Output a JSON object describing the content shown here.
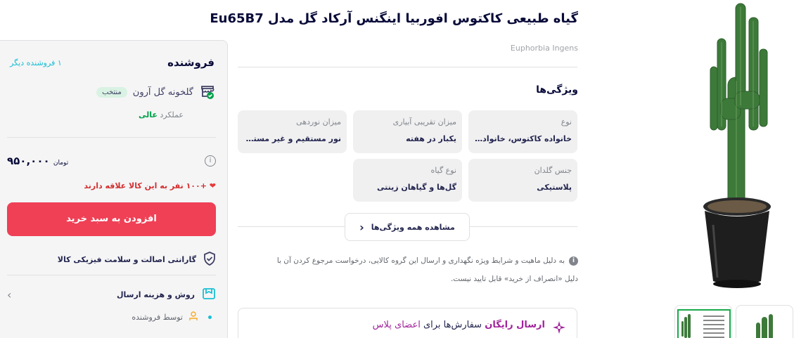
{
  "product": {
    "title": "گیاه طبیعی کاکتوس افوربیا اینگنس آرکاد گل مدل Eu65B7",
    "english_title": "Euphorbia Ingens"
  },
  "features": {
    "title": "ویژگی‌ها",
    "items": [
      {
        "key": "نوع",
        "value": "خانواده کاکتوس، خانواده‌س..."
      },
      {
        "key": "میزان تقریبی آبیاری",
        "value": "یکبار در هفته"
      },
      {
        "key": "میزان نوردهی",
        "value": "نور مستقیم و غیر مستقیم"
      },
      {
        "key": "جنس گلدان",
        "value": "پلاستیکی"
      },
      {
        "key": "نوع گیاه",
        "value": "گل‌ها و گیاهان زینتی"
      }
    ],
    "see_all_label": "مشاهده همه ویژگی‌ها"
  },
  "notice": {
    "line1": "به دلیل ماهیت و شرایط ویژه نگهداری و ارسال این گروه کالایی، درخواست مرجوع کردن آن با",
    "line2": "دلیل «انصراف از خرید» قابل تایید نیست."
  },
  "free_shipping": {
    "lead": "ارسال رایگان",
    "rest": "سفارش‌ها برای",
    "plus": "اعضای پلاس"
  },
  "seller": {
    "title": "فروشنده",
    "other_sellers": "۱ فروشنده دیگر",
    "name": "گلخونه گل آرون",
    "badge": "منتخب",
    "performance_label": "عملکرد",
    "performance_value": "عالی",
    "price": "۹۵۰,۰۰۰",
    "currency": "تومان",
    "favorites": "+۱۰۰ نفر به این کالا علاقه دارند",
    "add_to_cart": "افزودن به سبد خرید",
    "guarantee": "گارانتی اصالت و سلامت فیزیکی کالا",
    "shipping_label": "روش و هزینه ارسال",
    "by_seller": "توسط فروشنده"
  },
  "colors": {
    "primary_red": "#ef4056",
    "accent_teal": "#19bfd3",
    "success_green": "#00a049",
    "plus_purple": "#a1249b"
  }
}
